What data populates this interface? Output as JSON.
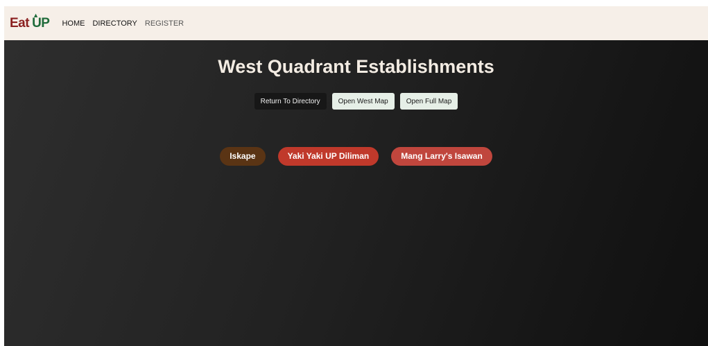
{
  "brand": {
    "eat": "Eat",
    "up": "UP",
    "arrow": "▲"
  },
  "nav": {
    "home": "HOME",
    "directory": "DIRECTORY",
    "register": "REGISTER"
  },
  "page": {
    "title": "West Quadrant Establishments"
  },
  "actions": {
    "return": "Return To Directory",
    "west_map": "Open West Map",
    "full_map": "Open Full Map"
  },
  "establishments": [
    {
      "name": "Iskape",
      "color": "#5a3414"
    },
    {
      "name": "Yaki Yaki UP Diliman",
      "color": "#c0392b"
    },
    {
      "name": "Mang Larry's Isawan",
      "color": "#c0463d"
    }
  ]
}
